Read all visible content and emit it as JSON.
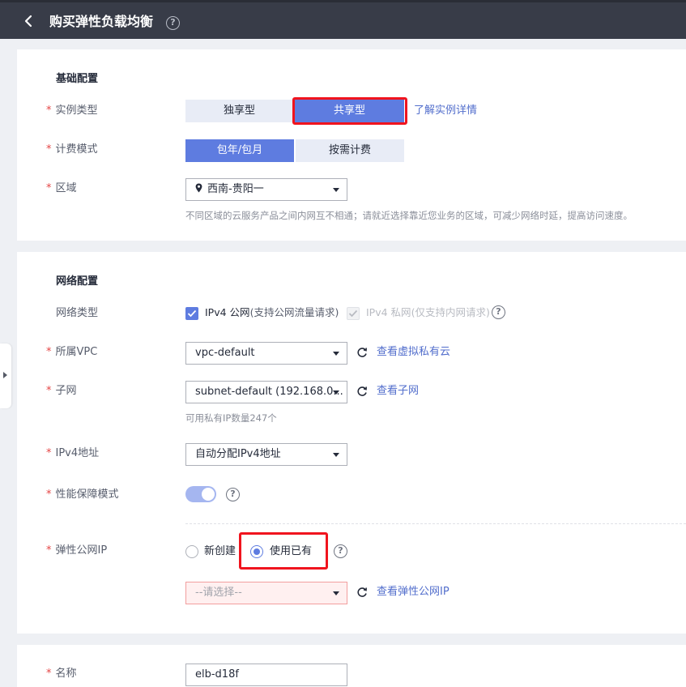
{
  "header": {
    "title": "购买弹性负载均衡",
    "help_icon": "question-circle-icon",
    "back_icon": "chevron-left-icon"
  },
  "basic_section": {
    "title": "基础配置",
    "instance_type": {
      "label": "实例类型",
      "options": [
        "独享型",
        "共享型"
      ],
      "selected": "共享型",
      "link": "了解实例详情"
    },
    "billing_mode": {
      "label": "计费模式",
      "options": [
        "包年/包月",
        "按需计费"
      ],
      "selected": "包年/包月"
    },
    "region": {
      "label": "区域",
      "value": "西南-贵阳一",
      "hint": "不同区域的云服务产品之间内网互不相通；请就近选择靠近您业务的区域，可减少网络时延，提高访问速度。"
    }
  },
  "network_section": {
    "title": "网络配置",
    "network_type": {
      "label": "网络类型",
      "ipv4_public": "IPv4 公网",
      "ipv4_public_note": "(支持公网流量请求)",
      "ipv4_private": "IPv4 私网",
      "ipv4_private_note": "(仅支持内网请求)"
    },
    "vpc": {
      "label": "所属VPC",
      "value": "vpc-default",
      "link": "查看虚拟私有云"
    },
    "subnet": {
      "label": "子网",
      "value": "subnet-default (192.168.0...",
      "link": "查看子网",
      "hint": "可用私有IP数量247个"
    },
    "ipv4_address": {
      "label": "IPv4地址",
      "value": "自动分配IPv4地址"
    },
    "performance_mode": {
      "label": "性能保障模式",
      "enabled": true
    },
    "eip": {
      "label": "弹性公网IP",
      "options": [
        "新创建",
        "使用已有"
      ],
      "selected": "使用已有",
      "placeholder": "--请选择--",
      "link": "查看弹性公网IP"
    }
  },
  "name_section": {
    "label": "名称",
    "value": "elb-d18f"
  },
  "colors": {
    "accent": "#5e7ce0",
    "link": "#526ecc",
    "required": "#e54545",
    "highlight": "#f0141e",
    "topbar": "#383c48"
  }
}
